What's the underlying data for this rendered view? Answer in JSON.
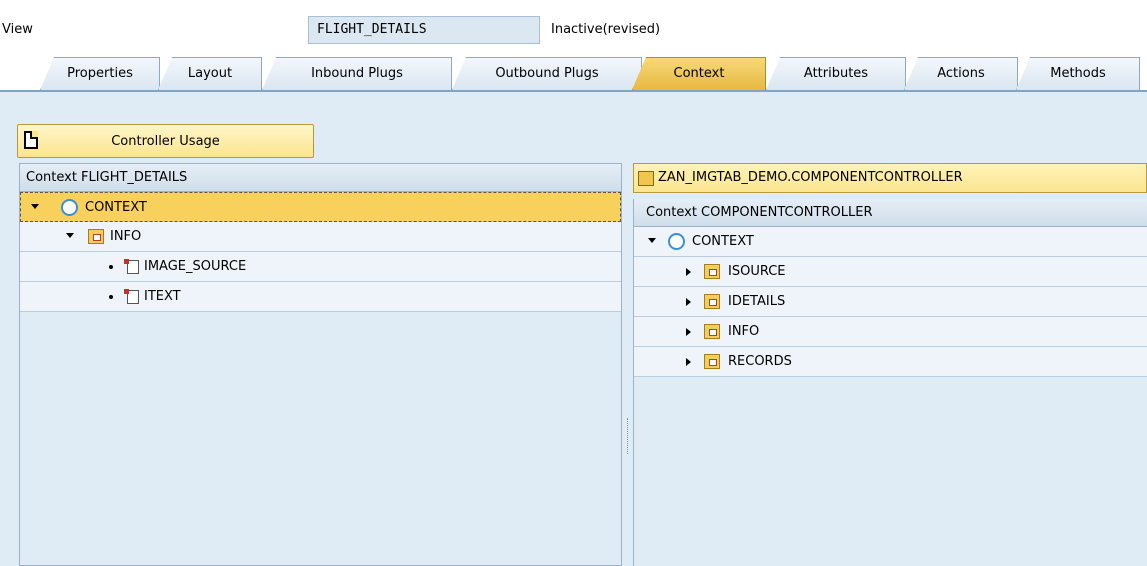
{
  "header": {
    "view_label": "View",
    "view_name": "FLIGHT_DETAILS",
    "status": "Inactive(revised)"
  },
  "tabs": [
    {
      "label": "Properties"
    },
    {
      "label": "Layout"
    },
    {
      "label": "Inbound Plugs"
    },
    {
      "label": "Outbound Plugs"
    },
    {
      "label": "Context",
      "active": true
    },
    {
      "label": "Attributes"
    },
    {
      "label": "Actions"
    },
    {
      "label": "Methods"
    }
  ],
  "toolbar": {
    "controller_usage_label": "Controller Usage"
  },
  "left_panel": {
    "title": "Context FLIGHT_DETAILS",
    "tree": [
      {
        "label": "CONTEXT",
        "type": "root"
      },
      {
        "label": "INFO",
        "type": "node"
      },
      {
        "label": "IMAGE_SOURCE",
        "type": "attribute"
      },
      {
        "label": "ITEXT",
        "type": "attribute"
      }
    ]
  },
  "right_panel": {
    "controller_title": "ZAN_IMGTAB_DEMO.COMPONENTCONTROLLER",
    "title": "Context COMPONENTCONTROLLER",
    "tree": [
      {
        "label": "CONTEXT",
        "type": "root"
      },
      {
        "label": "ISOURCE",
        "type": "node"
      },
      {
        "label": "IDETAILS",
        "type": "node"
      },
      {
        "label": "INFO",
        "type": "node"
      },
      {
        "label": "RECORDS",
        "type": "node"
      }
    ]
  }
}
